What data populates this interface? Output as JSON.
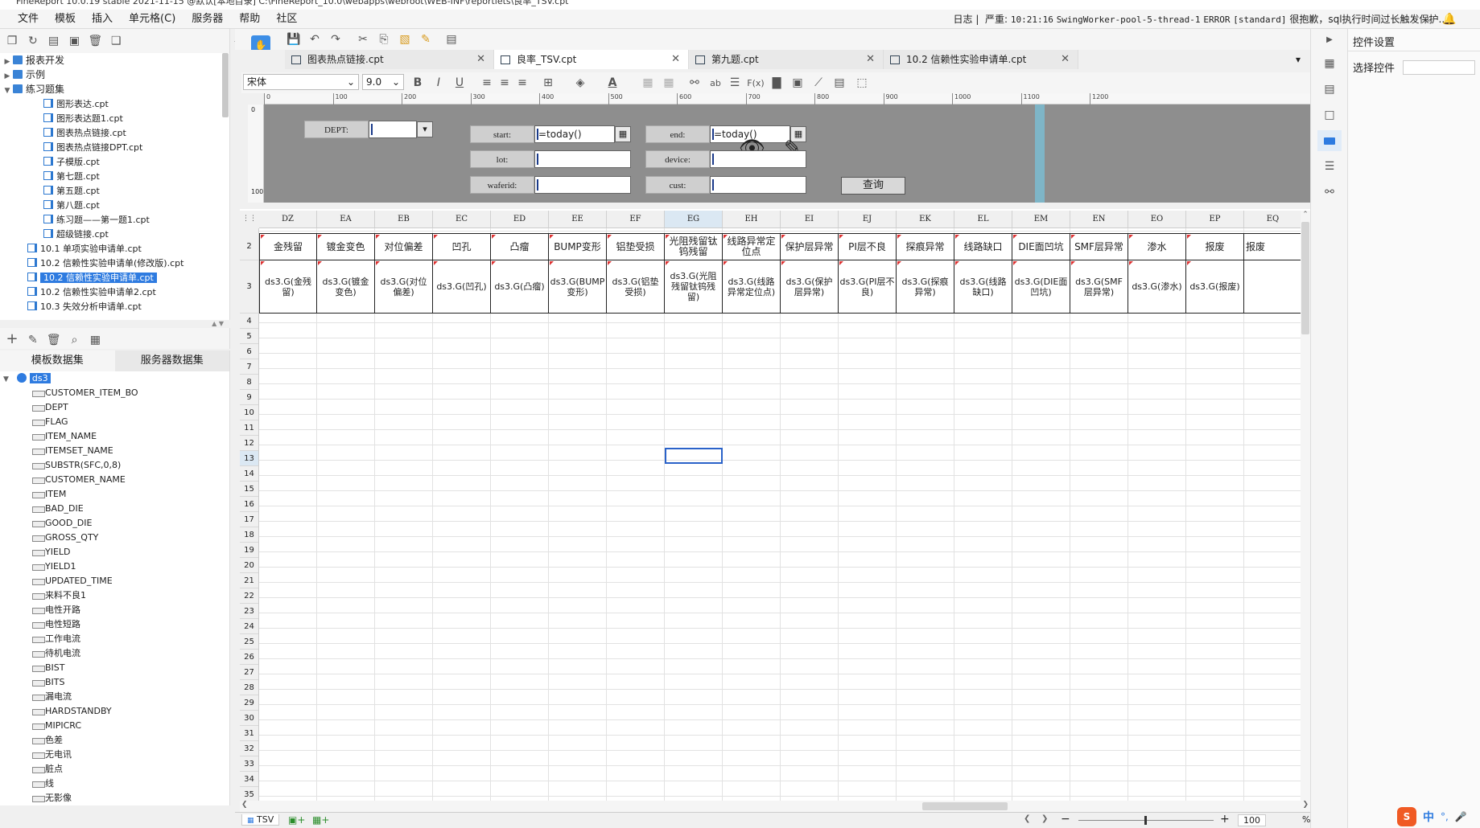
{
  "app": {
    "title": "FineReport 10.0.19 stable 2021-11-15 @默认[本地目录]    C:\\FineReport_10.0\\webapps\\webroot\\WEB-INF\\reportlets\\良率_TSV.cpt"
  },
  "menu": [
    "文件",
    "模板",
    "插入",
    "单元格(C)",
    "服务器",
    "帮助",
    "社区"
  ],
  "log": {
    "label": "日志",
    "level": "严重",
    "time": "10:21:16",
    "thread": "SwingWorker-pool-5-thread-1",
    "type": "ERROR",
    "module": "[standard]",
    "message": "很抱歉，sql执行时间过长触发保护..."
  },
  "tree": [
    {
      "label": "报表开发",
      "depth": 0,
      "type": "folder",
      "toggle": "▶"
    },
    {
      "label": "示例",
      "depth": 0,
      "type": "folder",
      "toggle": "▶"
    },
    {
      "label": "练习题集",
      "depth": 0,
      "type": "folder",
      "toggle": "▼"
    },
    {
      "label": "图形表达.cpt",
      "depth": 2,
      "type": "file"
    },
    {
      "label": "图形表达题1.cpt",
      "depth": 2,
      "type": "file"
    },
    {
      "label": "图表热点链接.cpt",
      "depth": 2,
      "type": "file"
    },
    {
      "label": "图表热点链接DPT.cpt",
      "depth": 2,
      "type": "file"
    },
    {
      "label": "子模版.cpt",
      "depth": 2,
      "type": "file"
    },
    {
      "label": "第七题.cpt",
      "depth": 2,
      "type": "file"
    },
    {
      "label": "第五题.cpt",
      "depth": 2,
      "type": "file"
    },
    {
      "label": "第八题.cpt",
      "depth": 2,
      "type": "file"
    },
    {
      "label": "练习题——第一题1.cpt",
      "depth": 2,
      "type": "file"
    },
    {
      "label": "超级链接.cpt",
      "depth": 2,
      "type": "file"
    },
    {
      "label": "10.1 单项实验申请单.cpt",
      "depth": 1,
      "type": "file"
    },
    {
      "label": "10.2 信赖性实验申请单(修改版).cpt",
      "depth": 1,
      "type": "file"
    },
    {
      "label": "10.2 信赖性实验申请单.cpt",
      "depth": 1,
      "type": "file",
      "selected": true
    },
    {
      "label": "10.2 信赖性实验申请单2.cpt",
      "depth": 1,
      "type": "file"
    },
    {
      "label": "10.3 失效分析申请单.cpt",
      "depth": 1,
      "type": "file"
    }
  ],
  "dataset_tabs": [
    "模板数据集",
    "服务器数据集"
  ],
  "dataset": {
    "name": "ds3",
    "fields": [
      "CUSTOMER_ITEM_BO",
      "DEPT",
      "FLAG",
      "ITEM_NAME",
      "ITEMSET_NAME",
      "SUBSTR(SFC,0,8)",
      "CUSTOMER_NAME",
      "ITEM",
      "BAD_DIE",
      "GOOD_DIE",
      "GROSS_QTY",
      "YIELD",
      "YIELD1",
      "UPDATED_TIME",
      "来料不良1",
      "电性开路",
      "电性短路",
      "工作电流",
      "待机电流",
      "BIST",
      "BITS",
      "漏电流",
      "HARDSTANDBY",
      "MIPICRC",
      "色差",
      "无电讯",
      "脏点",
      "线",
      "无影像"
    ]
  },
  "tabs": [
    {
      "label": "图表热点链接.cpt",
      "active": false
    },
    {
      "label": "良率_TSV.cpt",
      "active": true
    },
    {
      "label": "第九题.cpt",
      "active": false
    },
    {
      "label": "10.2 信赖性实验申请单.cpt",
      "active": false
    }
  ],
  "format": {
    "font": "宋体",
    "size": "9.0"
  },
  "ruler": [
    "0",
    "100",
    "200",
    "300",
    "400",
    "500",
    "600",
    "700",
    "800",
    "900",
    "1000",
    "1100",
    "1200"
  ],
  "params": {
    "dept_label": "DEPT:",
    "start_label": "start:",
    "end_label": "end:",
    "lot_label": "lot:",
    "device_label": "device:",
    "waferid_label": "waferid:",
    "cust_label": "cust:",
    "start_value": "=today()",
    "end_value": "=today()",
    "query_button": "查询"
  },
  "columns": [
    "DZ",
    "EA",
    "EB",
    "EC",
    "ED",
    "EE",
    "EF",
    "EG",
    "EH",
    "EI",
    "EJ",
    "EK",
    "EL",
    "EM",
    "EN",
    "EO",
    "EP",
    "EQ"
  ],
  "rows": [
    "2",
    "3",
    "4",
    "5",
    "6",
    "7",
    "8",
    "9",
    "10",
    "11",
    "12",
    "13",
    "14",
    "15",
    "16",
    "17",
    "18",
    "19",
    "20",
    "21",
    "22",
    "23",
    "24",
    "25",
    "26",
    "27",
    "28",
    "29",
    "30",
    "31",
    "32",
    "33",
    "34",
    "35"
  ],
  "header_row": [
    "金残留",
    "镀金变色",
    "对位偏差",
    "凹孔",
    "凸瘤",
    "BUMP变形",
    "铝垫受损",
    "光阻残留钛钨残留",
    "线路异常定位点",
    "保护层异常",
    "PI层不良",
    "探痕异常",
    "线路缺口",
    "DIE面凹坑",
    "SMF层异常",
    "渗水",
    "报废",
    "报废"
  ],
  "formula_row": [
    "ds3.G(金残留)",
    "ds3.G(镀金变色)",
    "ds3.G(对位偏差)",
    "ds3.G(凹孔)",
    "ds3.G(凸瘤)",
    "ds3.G(BUMP变形)",
    "ds3.G(铝垫受损)",
    "ds3.G(光阻残留钛钨残留)",
    "ds3.G(线路异常定位点)",
    "ds3.G(保护层异常)",
    "ds3.G(PI层不良)",
    "ds3.G(探痕异常)",
    "ds3.G(线路缺口)",
    "ds3.G(DIE面凹坑)",
    "ds3.G(SMF层异常)",
    "ds3.G(渗水)",
    "ds3.G(报废)",
    ""
  ],
  "sheet_tab": "TSV",
  "zoom": "100",
  "right": {
    "title": "控件设置",
    "select_label": "选择控件"
  },
  "ime": {
    "lang": "中"
  }
}
